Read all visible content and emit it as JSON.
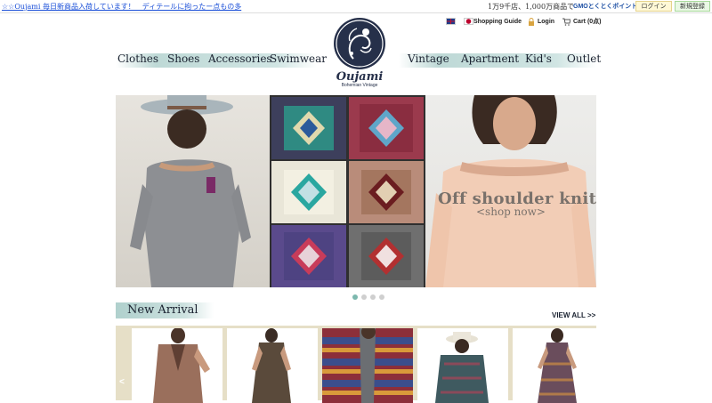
{
  "top_bar": {
    "announcement": "☆☆Oujami 毎日新商品入荷しています！　ディテールに拘ったー点もの多",
    "promo_text": "1万9千店、1,000万商品で使える",
    "gmo_badge": "GMOとくとくポイント",
    "login_label": "ログイン",
    "signup_label": "新規登録"
  },
  "util_nav": {
    "shopping_guide": "Shopping Guide",
    "login": "Login",
    "cart": "Cart (0点)"
  },
  "brand": {
    "name": "Oujami",
    "tagline": "Bohemian Vintage"
  },
  "main_nav": {
    "left": [
      "Clothes",
      "Shoes",
      "Accessories",
      "Swimwear"
    ],
    "right": [
      "Vintage",
      "Apartment",
      "Kid's",
      "Outlet"
    ]
  },
  "hero": {
    "title": "Off shoulder knit",
    "cta": "<shop now>",
    "active_slide": 1,
    "slide_count": 4
  },
  "new_arrival": {
    "title": "New Arrival",
    "view_all": "VIEW ALL >>",
    "prev_arrow": "<",
    "next_arrow": ">"
  },
  "colors": {
    "accent_teal": "#6faaa4",
    "carousel_bg": "#e6dfc7",
    "nav_text": "#1a2230"
  }
}
